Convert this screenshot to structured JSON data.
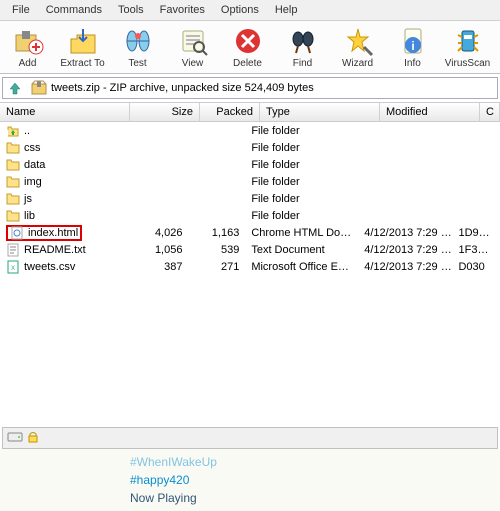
{
  "menu": [
    "File",
    "Commands",
    "Tools",
    "Favorites",
    "Options",
    "Help"
  ],
  "toolbar": [
    {
      "name": "add",
      "label": "Add"
    },
    {
      "name": "extract",
      "label": "Extract To"
    },
    {
      "name": "test",
      "label": "Test"
    },
    {
      "name": "view",
      "label": "View"
    },
    {
      "name": "delete",
      "label": "Delete"
    },
    {
      "name": "find",
      "label": "Find"
    },
    {
      "name": "wizard",
      "label": "Wizard"
    },
    {
      "name": "info",
      "label": "Info"
    },
    {
      "name": "virus",
      "label": "VirusScan"
    }
  ],
  "path": "tweets.zip - ZIP archive, unpacked size 524,409 bytes",
  "columns": [
    "Name",
    "Size",
    "Packed",
    "Type",
    "Modified",
    "C"
  ],
  "rows": [
    {
      "name": "..",
      "type": "File folder",
      "icon": "up"
    },
    {
      "name": "css",
      "type": "File folder",
      "icon": "folder"
    },
    {
      "name": "data",
      "type": "File folder",
      "icon": "folder"
    },
    {
      "name": "img",
      "type": "File folder",
      "icon": "folder"
    },
    {
      "name": "js",
      "type": "File folder",
      "icon": "folder"
    },
    {
      "name": "lib",
      "type": "File folder",
      "icon": "folder"
    },
    {
      "name": "index.html",
      "size": "4,026",
      "packed": "1,163",
      "type": "Chrome HTML Do…",
      "mod": "4/12/2013 7:29 …",
      "crc": "1D9…",
      "icon": "html",
      "hl": true
    },
    {
      "name": "README.txt",
      "size": "1,056",
      "packed": "539",
      "type": "Text Document",
      "mod": "4/12/2013 7:29 …",
      "crc": "1F3…",
      "icon": "txt"
    },
    {
      "name": "tweets.csv",
      "size": "387",
      "packed": "271",
      "type": "Microsoft Office E…",
      "mod": "4/12/2013 7:29 …",
      "crc": "D030",
      "icon": "csv"
    }
  ],
  "hashtags": [
    "#WhenIWakeUp",
    "#happy420",
    "Now Playing"
  ]
}
